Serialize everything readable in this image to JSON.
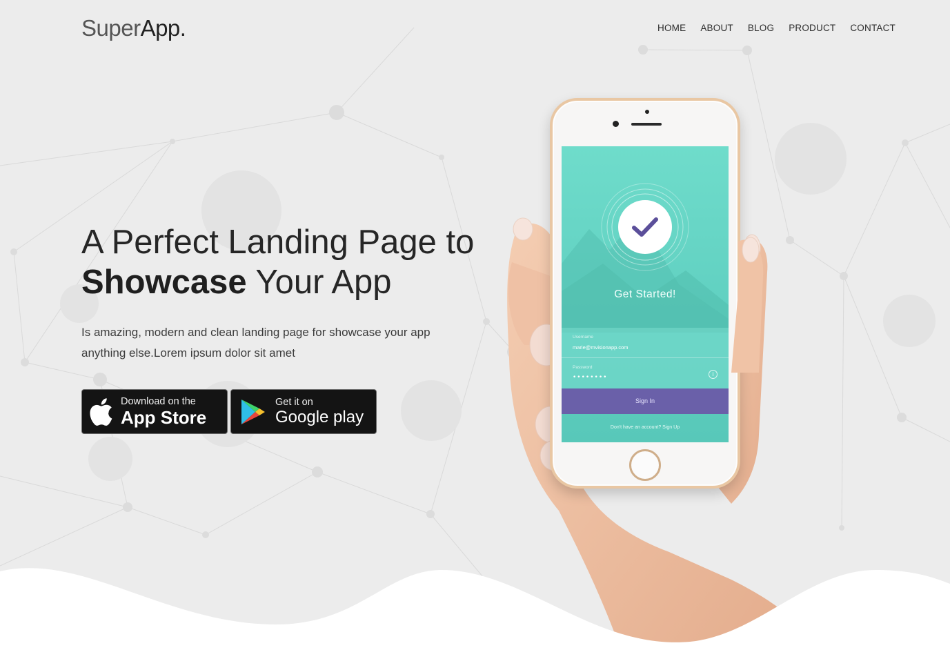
{
  "header": {
    "logo_light": "Super",
    "logo_bold": "App.",
    "nav": [
      "HOME",
      "ABOUT",
      "BLOG",
      "PRODUCT",
      "CONTACT"
    ]
  },
  "hero": {
    "headline_line1": "A Perfect Landing Page to",
    "headline_bold": "Showcase",
    "headline_rest": " Your App",
    "subtext": "Is amazing, modern and clean landing page for showcase your app anything else.Lorem ipsum dolor sit amet"
  },
  "store_buttons": {
    "apple_small": "Download on the",
    "apple_big": "App Store",
    "google_small": "Get it on",
    "google_big": "Google play"
  },
  "phone_screen": {
    "title": "Get Started!",
    "username_label": "Username",
    "username_value": "marie@mvisionapp.com",
    "password_label": "Password",
    "password_value": "••••••••",
    "signin_label": "Sign In",
    "signup_note": "Don't have an account? Sign Up"
  },
  "colors": {
    "background": "#ececec",
    "screen_teal": "#62d4c4",
    "signin_purple": "#6a60a9",
    "check_purple": "#5b4f9a",
    "button_dark": "#141414"
  },
  "icons": [
    "apple-icon",
    "google-play-icon",
    "check-icon",
    "info-icon"
  ]
}
